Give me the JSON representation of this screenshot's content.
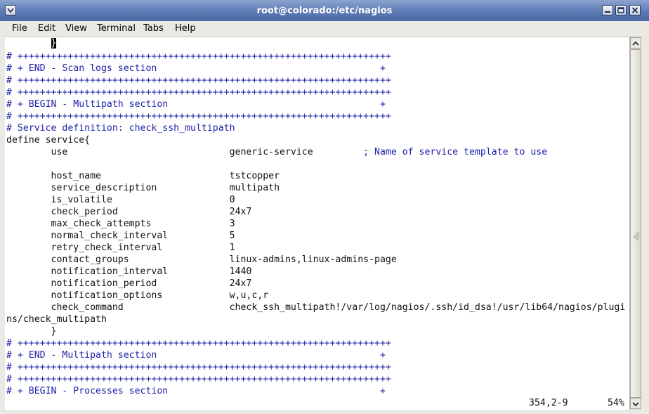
{
  "window": {
    "title": "root@colorado:/etc/nagios",
    "buttons": {
      "menu": "window-menu",
      "minimize": "minimize",
      "maximize": "maximize",
      "close": "close"
    }
  },
  "menubar": {
    "items": [
      "File",
      "Edit",
      "View",
      "Terminal",
      "Tabs",
      "Help"
    ]
  },
  "colors": {
    "comment": "#1e22a8",
    "text": "#111111",
    "titlebar": "#5d7bb5"
  },
  "terminal": {
    "cursor_char": "}",
    "lines": [
      {
        "t": "#",
        "comment": true,
        "text": "# +++++++++++++++++++++++++++++++++++++++++++++++++++++++++++++++++++"
      },
      {
        "comment": true,
        "text": "# + END - Scan logs section                                        +"
      },
      {
        "comment": true,
        "text": "# +++++++++++++++++++++++++++++++++++++++++++++++++++++++++++++++++++"
      },
      {
        "comment": true,
        "text": "# +++++++++++++++++++++++++++++++++++++++++++++++++++++++++++++++++++"
      },
      {
        "comment": true,
        "text": "# + BEGIN - Multipath section                                      +"
      },
      {
        "comment": true,
        "text": "# +++++++++++++++++++++++++++++++++++++++++++++++++++++++++++++++++++"
      },
      {
        "comment": true,
        "text": "# Service definition: check_ssh_multipath"
      },
      {
        "comment": false,
        "text": "define service{"
      },
      {
        "comment": false,
        "text": "        use                             generic-service",
        "trail": "         ; Name of service template to use"
      },
      {
        "comment": false,
        "text": ""
      },
      {
        "comment": false,
        "text": "        host_name                       tstcopper"
      },
      {
        "comment": false,
        "text": "        service_description             multipath"
      },
      {
        "comment": false,
        "text": "        is_volatile                     0"
      },
      {
        "comment": false,
        "text": "        check_period                    24x7"
      },
      {
        "comment": false,
        "text": "        max_check_attempts              3"
      },
      {
        "comment": false,
        "text": "        normal_check_interval           5"
      },
      {
        "comment": false,
        "text": "        retry_check_interval            1"
      },
      {
        "comment": false,
        "text": "        contact_groups                  linux-admins,linux-admins-page"
      },
      {
        "comment": false,
        "text": "        notification_interval           1440"
      },
      {
        "comment": false,
        "text": "        notification_period             24x7"
      },
      {
        "comment": false,
        "text": "        notification_options            w,u,c,r"
      },
      {
        "comment": false,
        "text": "        check_command                   check_ssh_multipath!/var/log/nagios/.ssh/id_dsa!/usr/lib64/nagios/plugi"
      },
      {
        "comment": false,
        "text": "ns/check_multipath"
      },
      {
        "comment": false,
        "text": "        }"
      },
      {
        "comment": true,
        "text": "# +++++++++++++++++++++++++++++++++++++++++++++++++++++++++++++++++++"
      },
      {
        "comment": true,
        "text": "# + END - Multipath section                                        +"
      },
      {
        "comment": true,
        "text": "# +++++++++++++++++++++++++++++++++++++++++++++++++++++++++++++++++++"
      },
      {
        "comment": true,
        "text": "# +++++++++++++++++++++++++++++++++++++++++++++++++++++++++++++++++++"
      },
      {
        "comment": true,
        "text": "# + BEGIN - Processes section                                      +"
      }
    ],
    "status": {
      "position": "354,2-9",
      "percent": "54%"
    }
  }
}
